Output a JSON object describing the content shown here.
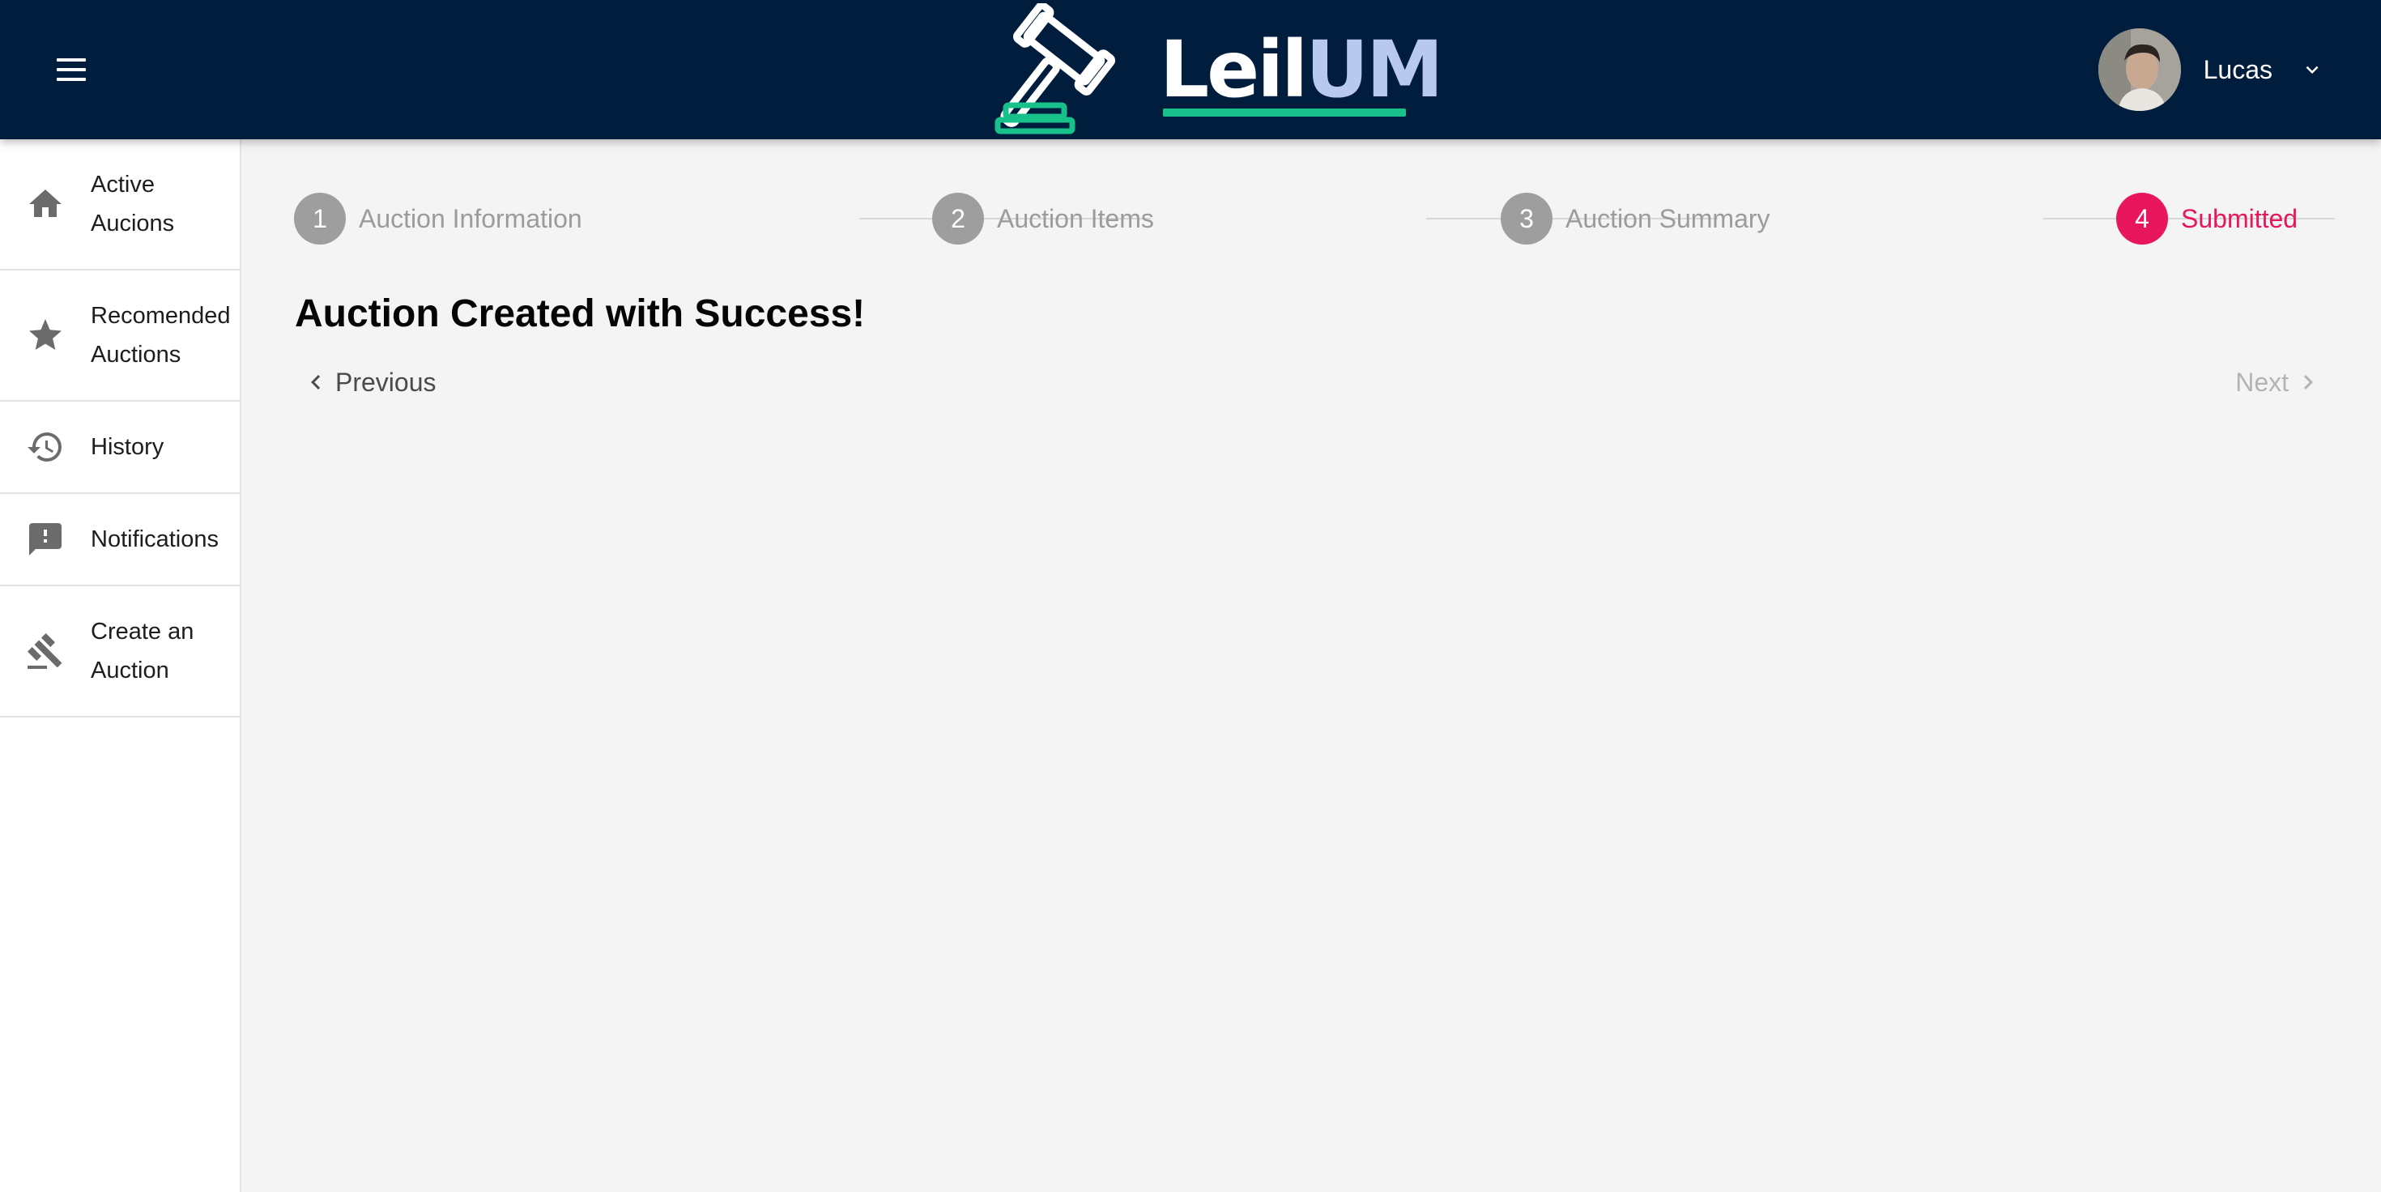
{
  "app": {
    "logo_text_main": "Leil",
    "logo_text_accent": "UM",
    "logo_icon": "gavel-icon",
    "menu_icon": "hamburger-menu-icon"
  },
  "user": {
    "name": "Lucas",
    "dropdown_icon": "chevron-down-icon"
  },
  "sidebar": {
    "items": [
      {
        "label": "Active Aucions",
        "icon": "home-icon"
      },
      {
        "label": "Recomended Auctions",
        "icon": "star-icon"
      },
      {
        "label": "History",
        "icon": "history-icon"
      },
      {
        "label": "Notifications",
        "icon": "feedback-icon"
      },
      {
        "label": "Create an Auction",
        "icon": "gavel-icon"
      }
    ]
  },
  "stepper": {
    "steps": [
      {
        "number": "1",
        "label": "Auction Information",
        "state": "inactive"
      },
      {
        "number": "2",
        "label": "Auction Items",
        "state": "inactive"
      },
      {
        "number": "3",
        "label": "Auction Summary",
        "state": "inactive"
      },
      {
        "number": "4",
        "label": "Submitted",
        "state": "active"
      }
    ]
  },
  "main": {
    "headline": "Auction Created with Success!",
    "previous_label": "Previous",
    "next_label": "Next"
  },
  "colors": {
    "header_bg": "#001d3d",
    "accent": "#e8175d",
    "logo_green": "#18c08a",
    "logo_um": "#b9c8ee",
    "step_inactive": "#9e9e9e",
    "page_bg": "#f4f4f4"
  }
}
